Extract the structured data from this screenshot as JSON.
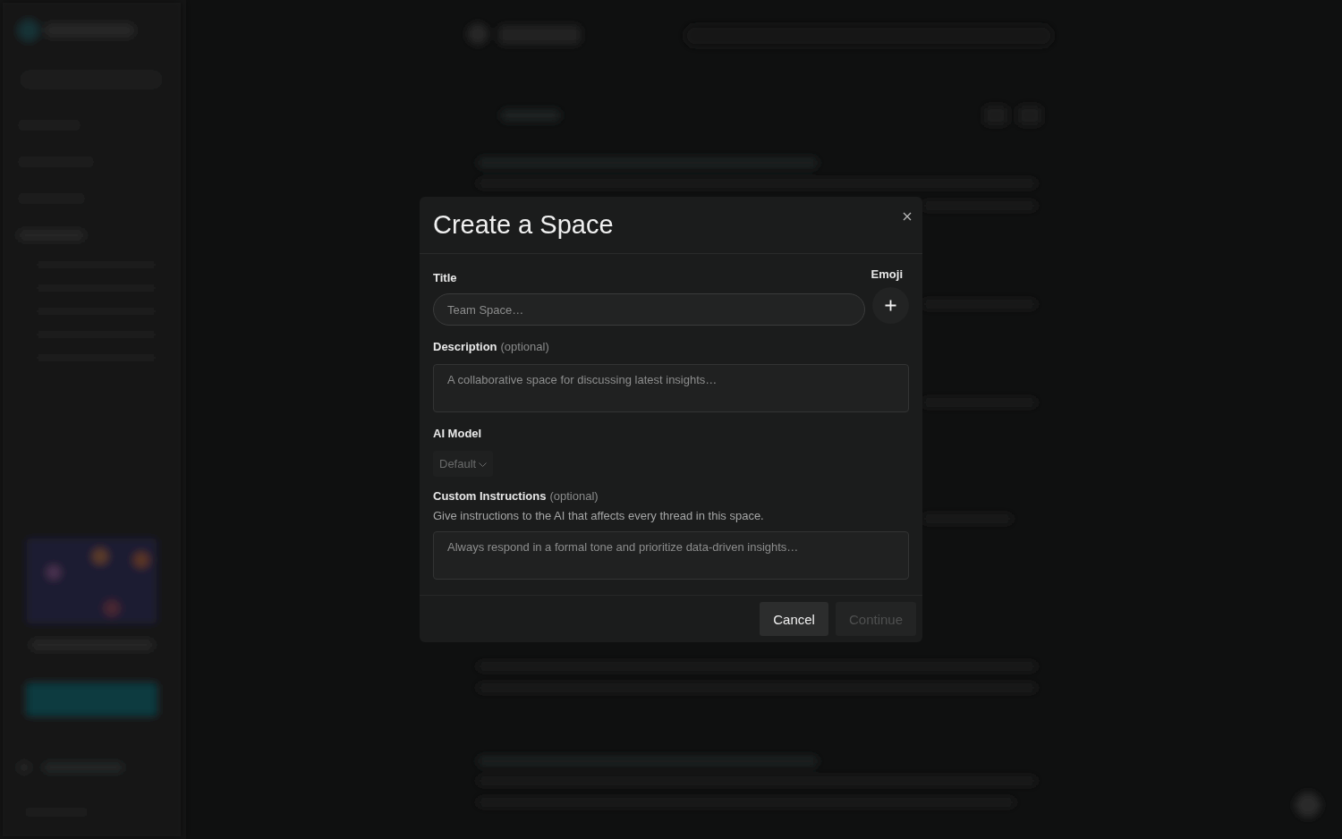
{
  "dialog": {
    "title": "Create a Space",
    "title_field": {
      "label": "Title",
      "placeholder": "Team Space…"
    },
    "emoji": {
      "label": "Emoji"
    },
    "description": {
      "label": "Description",
      "hint": "(optional)",
      "placeholder": "A collaborative space for discussing latest insights…"
    },
    "ai_model": {
      "label": "AI Model",
      "value": "Default",
      "disabled": true
    },
    "custom_instructions": {
      "label": "Custom Instructions",
      "hint": "(optional)",
      "help": "Give instructions to the AI that affects every thread in this space.",
      "placeholder": "Always respond in a formal tone and prioritize data-driven insights…"
    },
    "buttons": [
      {
        "label": "Cancel",
        "disabled": false
      },
      {
        "label": "Continue",
        "disabled": true
      }
    ]
  }
}
